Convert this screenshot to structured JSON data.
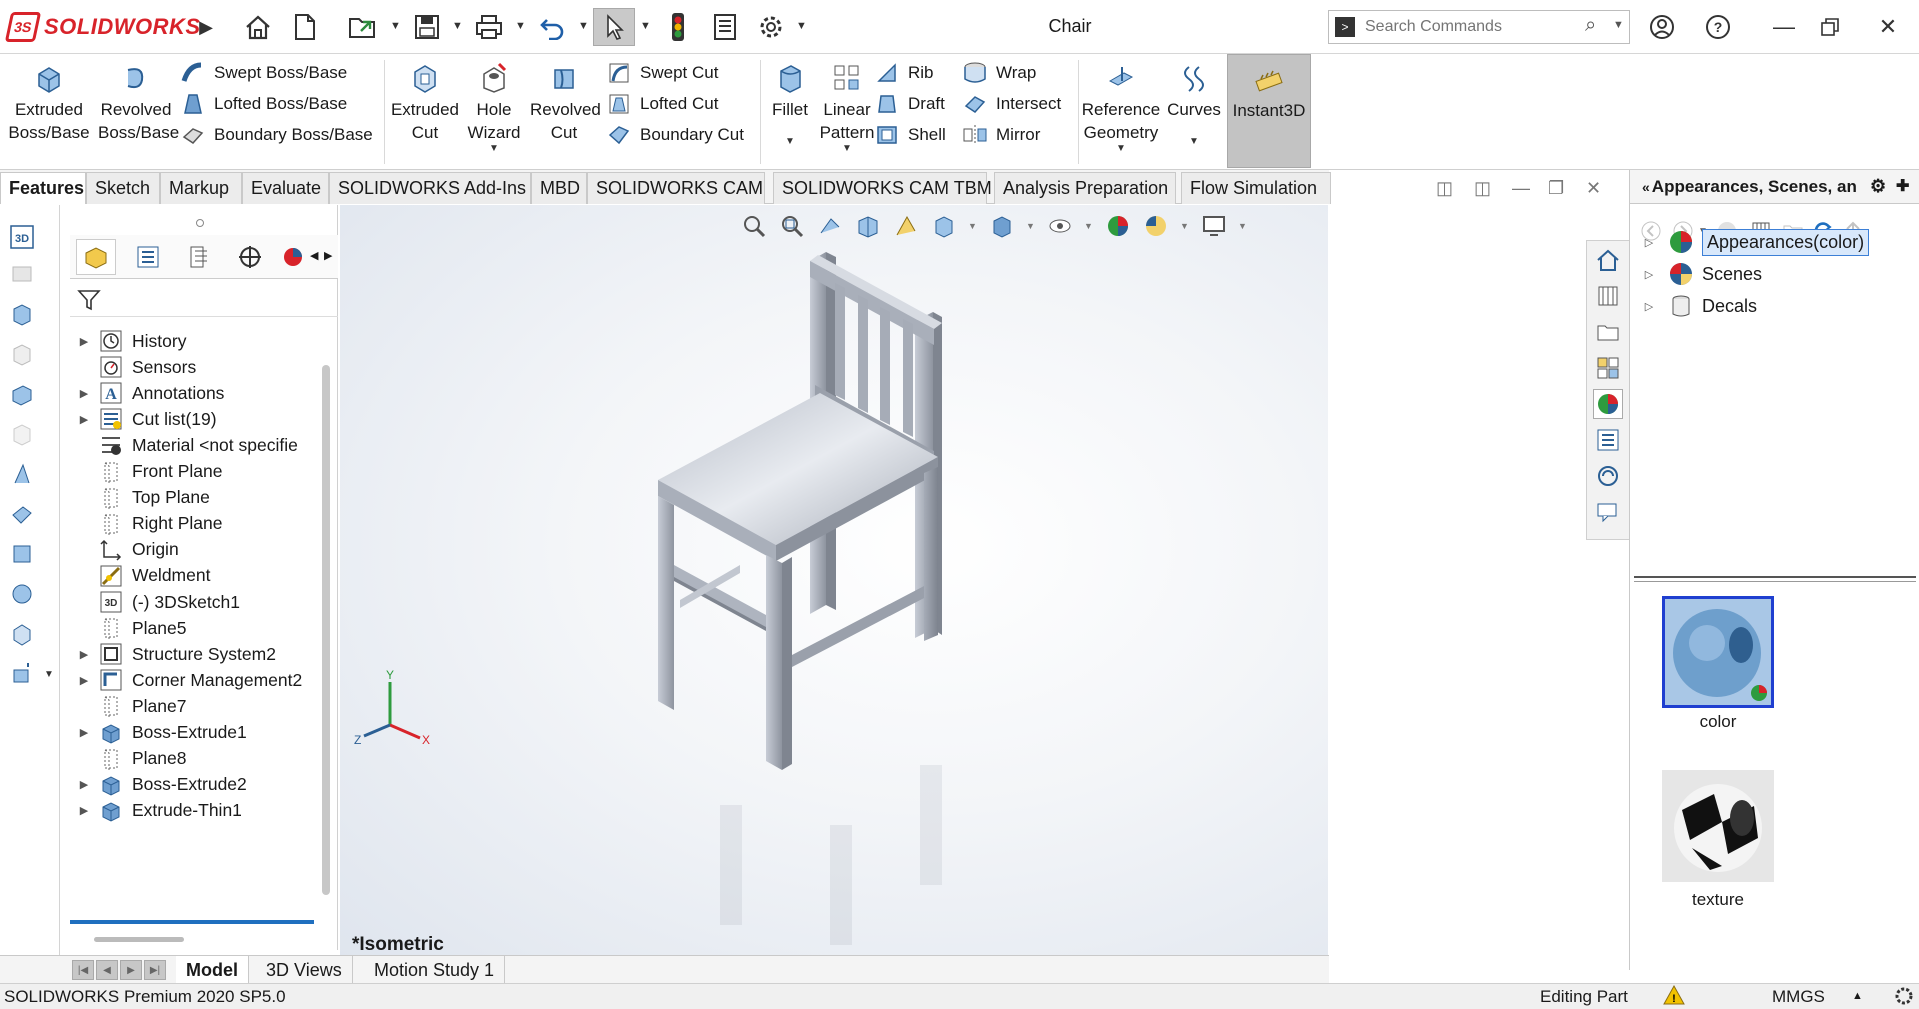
{
  "app": {
    "name": "SOLIDWORKS",
    "document_title": "Chair"
  },
  "search": {
    "placeholder": "Search Commands"
  },
  "command_manager": {
    "extruded_boss": "Extruded Boss/Base",
    "revolved_boss": "Revolved Boss/Base",
    "swept_boss": "Swept Boss/Base",
    "lofted_boss": "Lofted Boss/Base",
    "boundary_boss": "Boundary Boss/Base",
    "extruded_cut": "Extruded Cut",
    "hole_wizard": "Hole Wizard",
    "revolved_cut": "Revolved Cut",
    "swept_cut": "Swept Cut",
    "lofted_cut": "Lofted Cut",
    "boundary_cut": "Boundary Cut",
    "fillet": "Fillet",
    "linear_pattern": "Linear Pattern",
    "rib": "Rib",
    "draft": "Draft",
    "shell": "Shell",
    "wrap": "Wrap",
    "intersect": "Intersect",
    "mirror": "Mirror",
    "reference_geometry": "Reference Geometry",
    "curves": "Curves",
    "instant3d": "Instant3D"
  },
  "tabs": [
    "Features",
    "Sketch",
    "Markup",
    "Evaluate",
    "SOLIDWORKS Add-Ins",
    "MBD",
    "SOLIDWORKS CAM",
    "SOLIDWORKS CAM TBM",
    "Analysis Preparation",
    "Flow Simulation"
  ],
  "feature_tree": [
    {
      "label": "History",
      "expandable": true,
      "icon": "history-icon"
    },
    {
      "label": "Sensors",
      "expandable": false,
      "icon": "sensors-icon"
    },
    {
      "label": "Annotations",
      "expandable": true,
      "icon": "annotations-icon"
    },
    {
      "label": "Cut list(19)",
      "expandable": true,
      "icon": "cut-list-icon"
    },
    {
      "label": "Material <not specifie",
      "expandable": false,
      "icon": "material-icon"
    },
    {
      "label": "Front Plane",
      "expandable": false,
      "icon": "plane-icon"
    },
    {
      "label": "Top Plane",
      "expandable": false,
      "icon": "plane-icon"
    },
    {
      "label": "Right Plane",
      "expandable": false,
      "icon": "plane-icon"
    },
    {
      "label": "Origin",
      "expandable": false,
      "icon": "origin-icon"
    },
    {
      "label": "Weldment",
      "expandable": false,
      "icon": "weldment-icon"
    },
    {
      "label": "(-) 3DSketch1",
      "expandable": false,
      "icon": "3dsketch-icon"
    },
    {
      "label": "Plane5",
      "expandable": false,
      "icon": "plane-icon"
    },
    {
      "label": "Structure System2",
      "expandable": true,
      "icon": "structure-system-icon"
    },
    {
      "label": "Corner Management2",
      "expandable": true,
      "icon": "corner-management-icon"
    },
    {
      "label": "Plane7",
      "expandable": false,
      "icon": "plane-icon"
    },
    {
      "label": "Boss-Extrude1",
      "expandable": true,
      "icon": "extrude-icon"
    },
    {
      "label": "Plane8",
      "expandable": false,
      "icon": "plane-icon"
    },
    {
      "label": "Boss-Extrude2",
      "expandable": true,
      "icon": "extrude-icon"
    },
    {
      "label": "Extrude-Thin1",
      "expandable": true,
      "icon": "extrude-icon"
    }
  ],
  "viewport": {
    "view_label": "*Isometric",
    "axis": {
      "x": "X",
      "y": "Y",
      "z": "Z"
    }
  },
  "task_pane": {
    "title": "Appearances, Scenes, an",
    "items": [
      {
        "label": "Appearances(color)",
        "selected": true
      },
      {
        "label": "Scenes",
        "selected": false
      },
      {
        "label": "Decals",
        "selected": false
      }
    ],
    "swatches": [
      {
        "label": "color"
      },
      {
        "label": "texture"
      }
    ]
  },
  "bottom_tabs": [
    "Model",
    "3D Views",
    "Motion Study 1"
  ],
  "status": {
    "product": "SOLIDWORKS Premium 2020 SP5.0",
    "mode": "Editing Part",
    "units": "MMGS"
  },
  "colors": {
    "brand": "#d8232a",
    "selection": "#3c7fd6",
    "chair": "#9aa0ab"
  }
}
